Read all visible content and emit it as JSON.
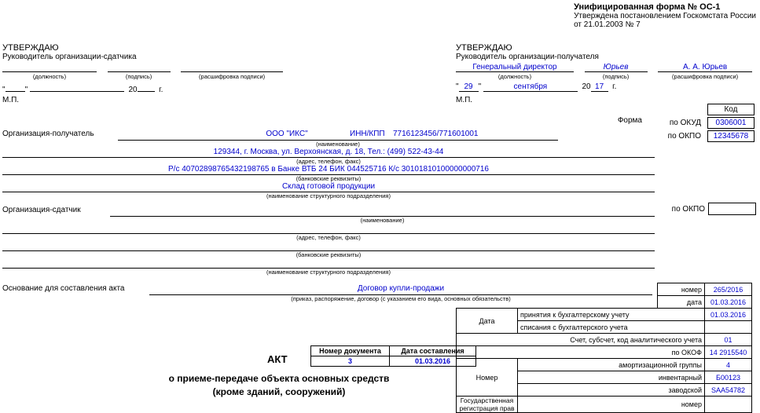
{
  "header": {
    "form_title": "Унифицированная форма № ОС-1",
    "form_approved": "Утверждена постановлением Госкомстата России",
    "form_date": "от 21.01.2003 № 7"
  },
  "approve_left": {
    "approve": "УТВЕРЖДАЮ",
    "head": "Руководитель организации-сдатчика",
    "position": "",
    "sign": "",
    "decoding": "",
    "cap_position": "(должность)",
    "cap_sign": "(подпись)",
    "cap_decoding": "(расшифровка подписи)",
    "day": "",
    "month": "",
    "year": "20",
    "year_end": "",
    "g": "г.",
    "mp": "М.П."
  },
  "approve_right": {
    "approve": "УТВЕРЖДАЮ",
    "head": "Руководитель организации-получателя",
    "position": "Генеральный директор",
    "sign_name": "Юрьев",
    "decoding": "А. А. Юрьев",
    "cap_position": "(должность)",
    "cap_sign": "(подпись)",
    "cap_decoding": "(расшифровка подписи)",
    "day": "29",
    "month": "сентября",
    "year": "20",
    "year_end": "17",
    "g": "г.",
    "mp": "М.П."
  },
  "codes": {
    "forma_label": "Форма",
    "okud_label": "по ОКУД",
    "okud": "0306001",
    "okpo_label": "по ОКПО",
    "okpo": "12345678",
    "kod_header": "Код"
  },
  "receiver": {
    "label": "Организация-получатель",
    "name": "ООО \"ИКС\"",
    "inn_label": "ИНН/КПП",
    "inn": "7716123456/771601001",
    "cap_name": "(наименование)",
    "address": "129344, г. Москва, ул. Верхоянская, д. 18, Тел.: (499) 522-43-44",
    "cap_address": "(адрес, телефон, факс)",
    "bank": "Р/с 40702898765432198765 в Банке ВТБ 24 БИК 044525716 К/с 30101810100000000716",
    "cap_bank": "(банковские реквизиты)",
    "dept": "Склад готовой продукции",
    "cap_dept": "(наименование структурного подразделения)"
  },
  "sender": {
    "label": "Организация-сдатчик",
    "cap_name": "(наименование)",
    "cap_address": "(адрес, телефон, факс)",
    "cap_bank": "(банковские реквизиты)",
    "cap_dept": "(наименование структурного подразделения)",
    "okpo_label": "по ОКПО"
  },
  "basis": {
    "label": "Основание для составления акта",
    "value": "Договор купли-продажи",
    "cap": "(приказ, распоряжение, договор (с указанием его вида, основных обязательств)",
    "nomer_label": "номер",
    "nomer": "265/2016",
    "data_label": "дата",
    "data": "01.03.2016"
  },
  "accounting": {
    "date_label": "Дата",
    "accept_label": "принятия к бухгалтерскому учету",
    "accept_date": "01.03.2016",
    "writeoff_label": "списания с бухгалтерского учета",
    "schet_label": "Счет, субсчет, код аналитического учета",
    "schet": "01",
    "okof_label": "по ОКОФ",
    "okof": "14 2915540",
    "nomer_label": "Номер",
    "amort_label": "амортизационной группы",
    "amort": "4",
    "inv_label": "инвентарный",
    "inv": "Б00123",
    "zav_label": "заводской",
    "zav": "SAA54782",
    "gos_label": "Государственная",
    "gos_label2": "регистрация прав",
    "gos_nomer_label": "номер"
  },
  "doc": {
    "num_header": "Номер документа",
    "date_header": "Дата составления",
    "num": "3",
    "date": "01.03.2016"
  },
  "akt": {
    "title": "АКТ",
    "line1": "о приеме-передаче объекта основных средств",
    "line2": "(кроме зданий, сооружений)"
  }
}
